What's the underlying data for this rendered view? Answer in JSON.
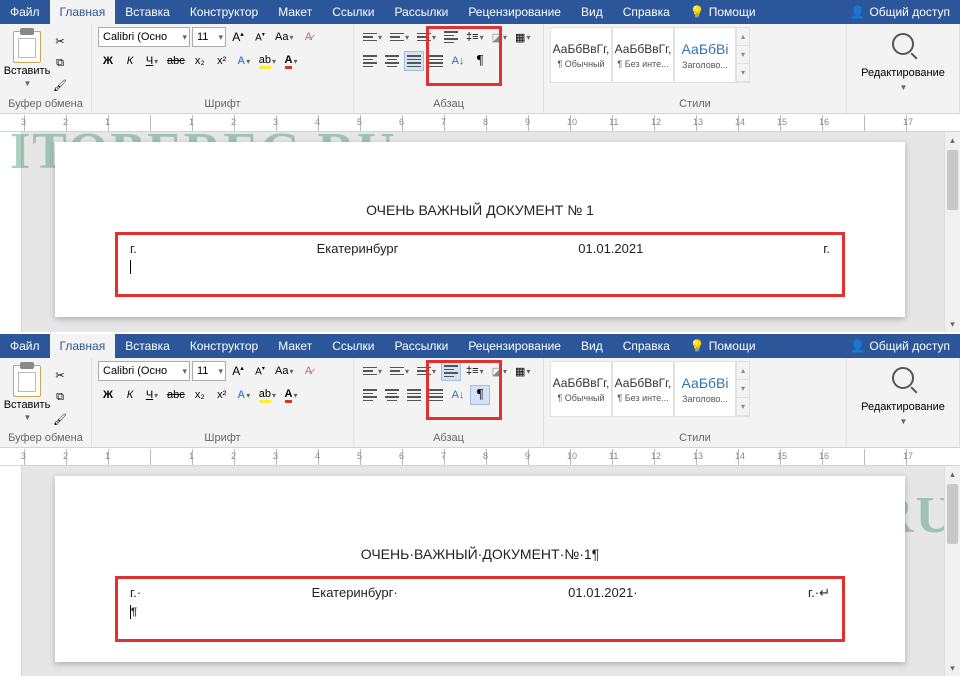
{
  "watermark": "ITOBEREG.RU",
  "menu": {
    "file": "Файл",
    "home": "Главная",
    "insert": "Вставка",
    "design": "Конструктор",
    "layout": "Макет",
    "references": "Ссылки",
    "mailings": "Рассылки",
    "review": "Рецензирование",
    "view": "Вид",
    "help": "Справка",
    "tell_me": "Помощи",
    "share": "Общий доступ"
  },
  "ribbon": {
    "clipboard": {
      "label": "Буфер обмена",
      "paste": "Вставить"
    },
    "font": {
      "label": "Шрифт",
      "name": "Calibri (Осно",
      "size": "11",
      "bold": "Ж",
      "italic": "К",
      "underline": "Ч",
      "strike": "abc",
      "sub": "x₂",
      "sup": "x²"
    },
    "paragraph": {
      "label": "Абзац"
    },
    "styles": {
      "label": "Стили",
      "sample": "АаБбВвГг,",
      "sample_h": "АаБбВі",
      "s1": "¶ Обычный",
      "s2": "¶ Без инте...",
      "s3": "Заголово..."
    },
    "editing": {
      "label": "Редактирование"
    }
  },
  "doc1": {
    "title": "ОЧЕНЬ ВАЖНЫЙ ДОКУМЕНТ № 1",
    "c1": "г.",
    "c2": "Екатеринбург",
    "c3": "01.01.2021",
    "c4": "г."
  },
  "doc2": {
    "title": "ОЧЕНЬ·ВАЖНЫЙ·ДОКУМЕНТ·№·1¶",
    "c1": "г.·",
    "c2": "Екатеринбург·",
    "c3": "01.01.2021·",
    "c4": "г.·↵",
    "cursor_line": "¶"
  },
  "ruler_ticks": [
    "3",
    "2",
    "1",
    "",
    "1",
    "2",
    "3",
    "4",
    "5",
    "6",
    "7",
    "8",
    "9",
    "10",
    "11",
    "12",
    "13",
    "14",
    "15",
    "16",
    "",
    "17"
  ]
}
